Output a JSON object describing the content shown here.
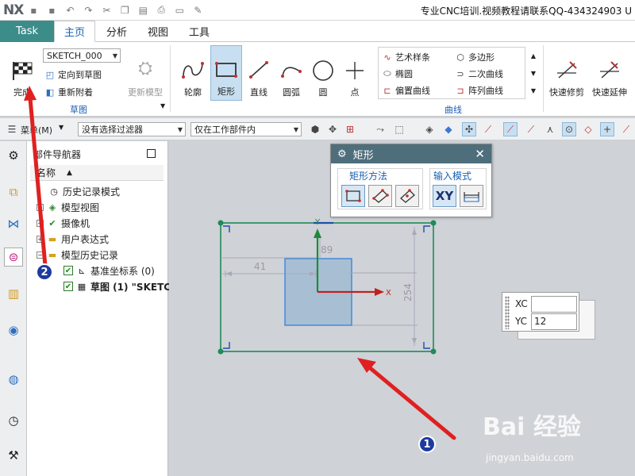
{
  "window": {
    "logo": "NX",
    "title": "专业CNC培训.视频教程请联系QQ-434324903 U"
  },
  "menu": {
    "task": "Task",
    "tabs": [
      {
        "label": "主页",
        "active": true
      },
      {
        "label": "分析",
        "active": false
      },
      {
        "label": "视图",
        "active": false
      },
      {
        "label": "工具",
        "active": false
      }
    ]
  },
  "ribbon": {
    "finish_label": "完成",
    "sketch_name": "SKETCH_000",
    "orient_label": "定向到草图",
    "reattach_label": "重新附着",
    "update_model_label": "更新模型",
    "sketch_group_label": "草图",
    "profile_label": "轮廓",
    "rectangle_label": "矩形",
    "line_label": "直线",
    "arc_label": "圆弧",
    "circle_label": "圆",
    "point_label": "点",
    "curve_items": [
      "艺术样条",
      "多边形",
      "椭圆",
      "二次曲线",
      "偏置曲线",
      "阵列曲线"
    ],
    "curve_group_label": "曲线",
    "quick_trim_label": "快速修剪",
    "quick_extend_label": "快速延伸"
  },
  "cmdbar": {
    "menu_label": "菜单(M)",
    "filter_value": "没有选择过滤器",
    "scope_value": "仅在工作部件内"
  },
  "navigator": {
    "title": "部件导航器",
    "column_header": "名称",
    "items": [
      {
        "label": "历史记录模式"
      },
      {
        "label": "模型视图"
      },
      {
        "label": "摄像机"
      },
      {
        "label": "用户表达式"
      },
      {
        "label": "模型历史记录"
      },
      {
        "label": "基准坐标系 (0)"
      },
      {
        "label": "草图 (1) \"SKETC"
      }
    ]
  },
  "rect_dialog": {
    "title": "矩形",
    "method_label": "矩形方法",
    "input_mode_label": "输入模式",
    "xy_label": "XY"
  },
  "sketch": {
    "dim_width": "41",
    "dim_height_small": "89",
    "dim_height_large": "254",
    "axis_x": "X",
    "axis_y": "Y"
  },
  "coord_input": {
    "xc_label": "XC",
    "xc_value": "",
    "yc_label": "YC",
    "yc_value": "12"
  },
  "annotations": {
    "badge1": "1",
    "badge2": "2",
    "arrow_color": "#e02020"
  },
  "watermark": {
    "logo_text": "Bai 经验",
    "url": "jingyan.baidu.com"
  },
  "colors": {
    "task_tab": "#3c8d8a",
    "dialog_title": "#4e6e7c",
    "sketch_rect": "#1f8a5a",
    "accent_blue": "#1a5fb4"
  }
}
